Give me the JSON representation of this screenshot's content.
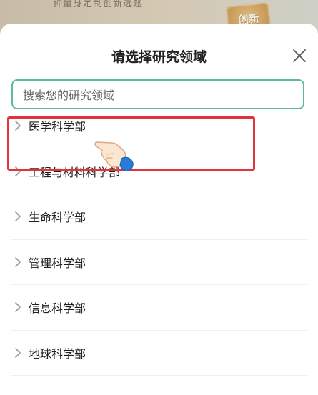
{
  "background": {
    "header_text": "钟量身定制创新选题",
    "badge_text": "创新"
  },
  "sheet": {
    "title": "请选择研究领域",
    "close_icon": "close-icon",
    "search": {
      "placeholder": "搜索您的研究领域",
      "value": ""
    },
    "items": [
      {
        "label": "医学科学部",
        "icon": "chevron-right-icon",
        "highlighted": true
      },
      {
        "label": "工程与材料科学部",
        "icon": "chevron-right-icon"
      },
      {
        "label": "生命科学部",
        "icon": "chevron-right-icon"
      },
      {
        "label": "管理科学部",
        "icon": "chevron-right-icon"
      },
      {
        "label": "信息科学部",
        "icon": "chevron-right-icon"
      },
      {
        "label": "地球科学部",
        "icon": "chevron-right-icon"
      }
    ]
  },
  "colors": {
    "accent": "#5dbd96",
    "highlight": "#e2323a"
  },
  "annotation_icon": "hand-pointer-icon"
}
